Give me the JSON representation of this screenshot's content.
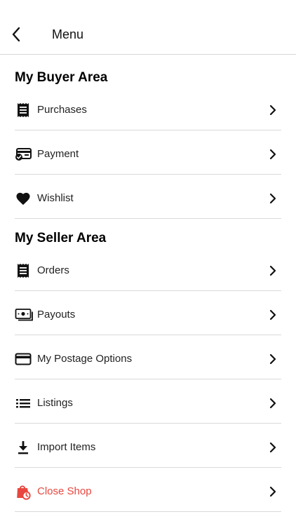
{
  "header": {
    "title": "Menu",
    "back_icon": "chevron-left-icon"
  },
  "buyer_section": {
    "title": "My Buyer Area",
    "items": [
      {
        "label": "Purchases",
        "icon": "receipt-icon"
      },
      {
        "label": "Payment",
        "icon": "card-check-icon"
      },
      {
        "label": "Wishlist",
        "icon": "heart-icon"
      }
    ]
  },
  "seller_section": {
    "title": "My Seller Area",
    "items": [
      {
        "label": "Orders",
        "icon": "receipt-icon"
      },
      {
        "label": "Payouts",
        "icon": "cash-icon"
      },
      {
        "label": "My Postage Options",
        "icon": "credit-card-icon"
      },
      {
        "label": "Listings",
        "icon": "list-icon"
      },
      {
        "label": "Import Items",
        "icon": "download-icon"
      },
      {
        "label": "Close Shop",
        "icon": "shop-closed-icon"
      }
    ]
  },
  "colors": {
    "danger": "#e8473f",
    "divider": "#d9d9d9",
    "text": "#111111"
  }
}
